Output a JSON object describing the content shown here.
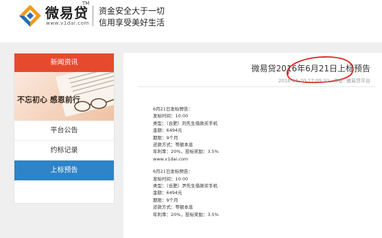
{
  "header": {
    "logo_name": "微易贷",
    "logo_tm": "TM",
    "logo_url": "www.v1dai.com",
    "slogan_line1": "资金安全大于一切",
    "slogan_line2": "信用享受美好生活"
  },
  "sidebar": {
    "heading": "新闻资讯",
    "banner_text": "不忘初心  感恩前行",
    "items": [
      {
        "label": "平台公告"
      },
      {
        "label": "约标记录"
      },
      {
        "label": "上标预告"
      }
    ]
  },
  "article": {
    "title": "微易贷2016年6月21日上标预告",
    "date": "2016-06-20 17:09:32",
    "author": "作者: 微易贷平台",
    "blocks": [
      {
        "lines": [
          "6月21日发标预告：",
          "发标时间：10:00",
          "类型：（合肥）刘先生借款买手机",
          "金额：6494元",
          "期限：9个月",
          "还款方式：等额本息",
          "年利率：20%，投标奖励：3.5%",
          "www.v1dai.com"
        ]
      },
      {
        "lines": [
          "6月21日发标预告：",
          "发标时间：10:00",
          "类型：（合肥）尹先生借款买手机",
          "金额：6494元",
          "期限：9个月",
          "还款方式：等额本息",
          "年利率：20%，投标奖励：3.5%"
        ]
      }
    ]
  },
  "colors": {
    "sidebar_header": "#e64a2e",
    "active_item": "#2d84c8",
    "annotation": "#d9251c"
  }
}
